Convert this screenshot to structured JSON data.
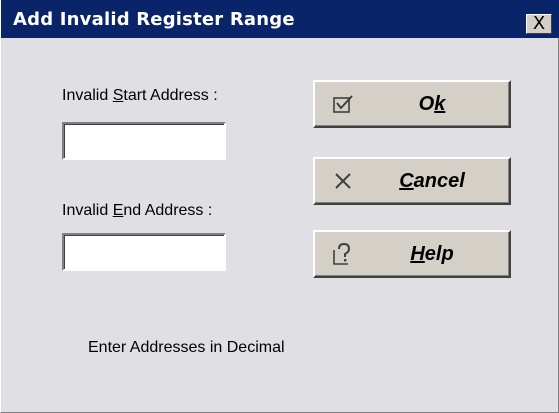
{
  "window": {
    "title": "Add Invalid Register Range",
    "close_glyph": "X"
  },
  "form": {
    "start_label": {
      "before": "Invalid ",
      "accel": "S",
      "after": "tart Address :"
    },
    "start_value": "",
    "end_label": {
      "before": "Invalid ",
      "accel": "E",
      "after": "nd Address :"
    },
    "end_value": ""
  },
  "buttons": {
    "ok": {
      "before": "O",
      "accel": "k",
      "after": "",
      "icon": "checkmark-box-icon"
    },
    "cancel": {
      "before": "",
      "accel": "C",
      "after": "ancel",
      "icon": "x-cross-icon"
    },
    "help": {
      "before": "",
      "accel": "H",
      "after": "elp",
      "icon": "help-question-icon"
    }
  },
  "hint": "Enter Addresses in Decimal"
}
